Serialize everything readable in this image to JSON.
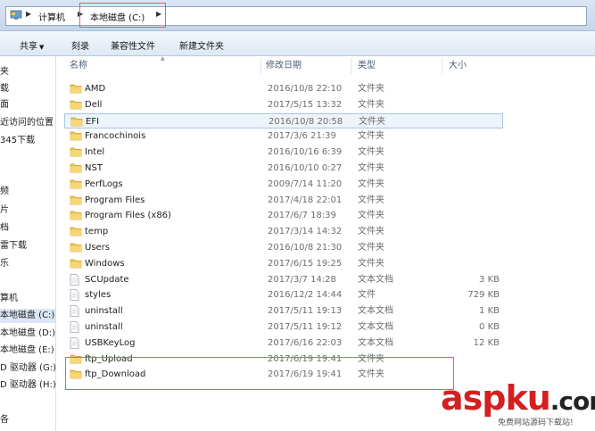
{
  "address": {
    "crumbs": [
      "计算机",
      "本地磁盘 (C:)"
    ]
  },
  "toolbar": {
    "share_label": "共享",
    "burn_label": "刻录",
    "compat_label": "兼容性文件",
    "new_folder_label": "新建文件夹"
  },
  "nav": {
    "items": [
      {
        "label": "夹"
      },
      {
        "label": "载"
      },
      {
        "label": "面"
      },
      {
        "label": "近访问的位置"
      },
      {
        "label": "345下载"
      },
      {
        "label": "频"
      },
      {
        "label": "片"
      },
      {
        "label": "档"
      },
      {
        "label": "雷下载"
      },
      {
        "label": "乐"
      },
      {
        "label": "算机"
      },
      {
        "label": "本地磁盘 (C:)"
      },
      {
        "label": "本地磁盘 (D:)"
      },
      {
        "label": "本地磁盘 (E:)"
      },
      {
        "label": "D 驱动器 (G:)"
      },
      {
        "label": "D 驱动器 (H:)"
      },
      {
        "label": "各"
      }
    ]
  },
  "columns": {
    "name": "名称",
    "date": "修改日期",
    "type": "类型",
    "size": "大小"
  },
  "files": [
    {
      "name": "AMD",
      "date": "2016/10/8 22:10",
      "type": "文件夹",
      "size": "",
      "kind": "folder"
    },
    {
      "name": "Dell",
      "date": "2017/5/15 13:32",
      "type": "文件夹",
      "size": "",
      "kind": "folder"
    },
    {
      "name": "EFI",
      "date": "2016/10/8 20:58",
      "type": "文件夹",
      "size": "",
      "kind": "folder"
    },
    {
      "name": "Francochinois",
      "date": "2017/3/6 21:39",
      "type": "文件夹",
      "size": "",
      "kind": "folder"
    },
    {
      "name": "Intel",
      "date": "2016/10/16 6:39",
      "type": "文件夹",
      "size": "",
      "kind": "folder"
    },
    {
      "name": "NST",
      "date": "2016/10/10 0:27",
      "type": "文件夹",
      "size": "",
      "kind": "folder"
    },
    {
      "name": "PerfLogs",
      "date": "2009/7/14 11:20",
      "type": "文件夹",
      "size": "",
      "kind": "folder"
    },
    {
      "name": "Program Files",
      "date": "2017/4/18 22:01",
      "type": "文件夹",
      "size": "",
      "kind": "folder"
    },
    {
      "name": "Program Files (x86)",
      "date": "2017/6/7 18:39",
      "type": "文件夹",
      "size": "",
      "kind": "folder"
    },
    {
      "name": "temp",
      "date": "2017/3/14 14:32",
      "type": "文件夹",
      "size": "",
      "kind": "folder"
    },
    {
      "name": "Users",
      "date": "2016/10/8 21:30",
      "type": "文件夹",
      "size": "",
      "kind": "folder"
    },
    {
      "name": "Windows",
      "date": "2017/6/15 19:25",
      "type": "文件夹",
      "size": "",
      "kind": "folder"
    },
    {
      "name": "SCUpdate",
      "date": "2017/3/7 14:28",
      "type": "文本文档",
      "size": "3 KB",
      "kind": "file"
    },
    {
      "name": "styles",
      "date": "2016/12/2 14:44",
      "type": "文件",
      "size": "729 KB",
      "kind": "file"
    },
    {
      "name": "uninstall",
      "date": "2017/5/11 19:13",
      "type": "文本文档",
      "size": "1 KB",
      "kind": "file"
    },
    {
      "name": "uninstall",
      "date": "2017/5/11 19:12",
      "type": "文本文档",
      "size": "0 KB",
      "kind": "file"
    },
    {
      "name": "USBKeyLog",
      "date": "2017/6/16 22:03",
      "type": "文本文档",
      "size": "12 KB",
      "kind": "file"
    },
    {
      "name": "ftp_Upload",
      "date": "2017/6/19 19:41",
      "type": "文件夹",
      "size": "",
      "kind": "folder"
    },
    {
      "name": "ftp_Download",
      "date": "2017/6/19 19:41",
      "type": "文件夹",
      "size": "",
      "kind": "folder"
    }
  ],
  "watermark": {
    "brand_a": "asp",
    "brand_b": "ku",
    "brand_c": ".com",
    "sub": "免费网站源码下载站!"
  }
}
